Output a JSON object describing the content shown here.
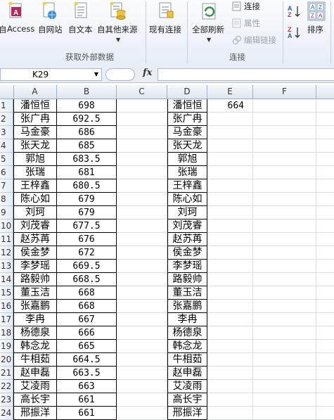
{
  "ribbon": {
    "buttons": {
      "access": "Access",
      "web": "自网站",
      "text": "自文本",
      "other": "自其他来源",
      "existing": "现有连接",
      "refresh_all": "全部刷新",
      "connections": "连接",
      "properties": "属性",
      "edit_links": "编辑链接",
      "sort": "排序",
      "left_cut": "自"
    },
    "groups": {
      "get_external": "获取外部数据",
      "connections": "连接"
    }
  },
  "formula_bar": {
    "name_box": "K29",
    "fx": "fx",
    "formula": ""
  },
  "columns": [
    "A",
    "B",
    "C",
    "D",
    "E",
    "F"
  ],
  "rows": [
    {
      "n": "1",
      "a": "潘恒恒",
      "b": "698",
      "d": "潘恒恒",
      "e": "664"
    },
    {
      "n": "2",
      "a": "张广冉",
      "b": "692.5",
      "d": "张广冉",
      "e": ""
    },
    {
      "n": "3",
      "a": "马金豪",
      "b": "686",
      "d": "马金豪",
      "e": ""
    },
    {
      "n": "4",
      "a": "张天龙",
      "b": "685",
      "d": "张天龙",
      "e": ""
    },
    {
      "n": "5",
      "a": "郭旭",
      "b": "683.5",
      "d": "郭旭",
      "e": ""
    },
    {
      "n": "6",
      "a": "张瑞",
      "b": "681",
      "d": "张瑞",
      "e": ""
    },
    {
      "n": "7",
      "a": "王梓鑫",
      "b": "680.5",
      "d": "王梓鑫",
      "e": ""
    },
    {
      "n": "8",
      "a": "陈心如",
      "b": "679",
      "d": "陈心如",
      "e": ""
    },
    {
      "n": "9",
      "a": "刘珂",
      "b": "679",
      "d": "刘珂",
      "e": ""
    },
    {
      "n": "10",
      "a": "刘茂睿",
      "b": "677.5",
      "d": "刘茂睿",
      "e": ""
    },
    {
      "n": "11",
      "a": "赵苏苒",
      "b": "676",
      "d": "赵苏苒",
      "e": ""
    },
    {
      "n": "12",
      "a": "侯金梦",
      "b": "672",
      "d": "侯金梦",
      "e": ""
    },
    {
      "n": "13",
      "a": "李梦瑶",
      "b": "669.5",
      "d": "李梦瑶",
      "e": ""
    },
    {
      "n": "14",
      "a": "路毅帅",
      "b": "668.5",
      "d": "路毅帅",
      "e": ""
    },
    {
      "n": "15",
      "a": "董玉洁",
      "b": "668",
      "d": "董玉洁",
      "e": ""
    },
    {
      "n": "16",
      "a": "张嘉鹏",
      "b": "668",
      "d": "张嘉鹏",
      "e": ""
    },
    {
      "n": "17",
      "a": "李冉",
      "b": "667",
      "d": "李冉",
      "e": ""
    },
    {
      "n": "18",
      "a": "杨德泉",
      "b": "666",
      "d": "杨德泉",
      "e": ""
    },
    {
      "n": "19",
      "a": "韩念龙",
      "b": "665",
      "d": "韩念龙",
      "e": ""
    },
    {
      "n": "20",
      "a": "牛相茹",
      "b": "664.5",
      "d": "牛相茹",
      "e": ""
    },
    {
      "n": "21",
      "a": "赵申磊",
      "b": "663.5",
      "d": "赵申磊",
      "e": ""
    },
    {
      "n": "22",
      "a": "艾凌雨",
      "b": "663",
      "d": "艾凌雨",
      "e": ""
    },
    {
      "n": "23",
      "a": "高长宇",
      "b": "661",
      "d": "高长宇",
      "e": ""
    },
    {
      "n": "24",
      "a": "邢振洋",
      "b": "661",
      "d": "邢振洋",
      "e": ""
    }
  ]
}
